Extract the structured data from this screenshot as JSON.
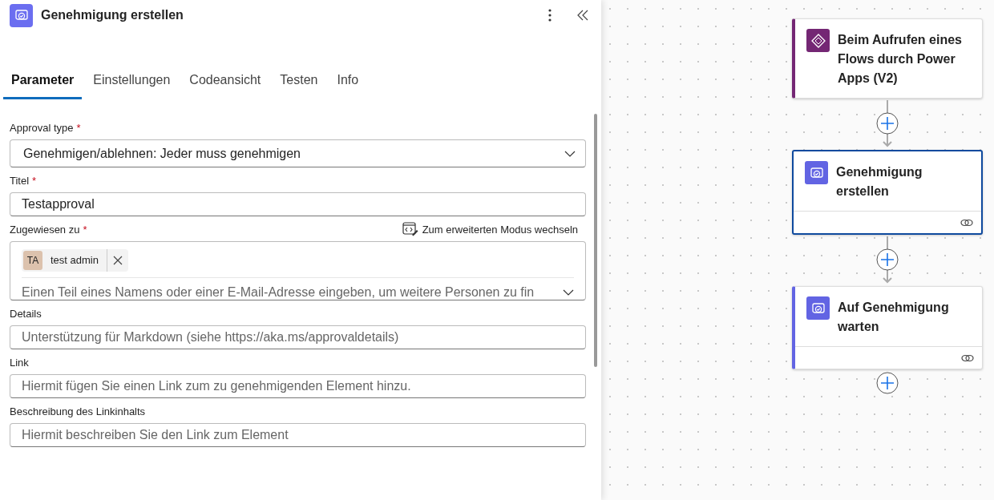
{
  "panel": {
    "title": "Genehmigung erstellen",
    "tabs": [
      {
        "label": "Parameter",
        "selected": true
      },
      {
        "label": "Einstellungen",
        "selected": false
      },
      {
        "label": "Codeansicht",
        "selected": false
      },
      {
        "label": "Testen",
        "selected": false
      },
      {
        "label": "Info",
        "selected": false
      }
    ],
    "fields": [
      {
        "kind": "dropdown",
        "label": "Approval type",
        "required_mark": "*",
        "value": "Genehmigen/ablehnen: Jeder muss genehmigen"
      },
      {
        "kind": "text",
        "label": "Titel",
        "required_mark": "*",
        "value": "Testapproval"
      },
      {
        "kind": "people",
        "label": "Zugewiesen zu",
        "required_mark": "*",
        "action": "Zum erweiterten Modus wechseln",
        "people": [
          {
            "initials": "TA",
            "name": "test admin"
          }
        ],
        "placeholder": "Einen Teil eines Namens oder einer E-Mail-Adresse eingeben, um weitere Personen zu fin"
      },
      {
        "kind": "text",
        "label": "Details",
        "placeholder": "Unterstützung für Markdown (siehe https://aka.ms/approvaldetails)"
      },
      {
        "kind": "text",
        "label": "Link",
        "placeholder": "Hiermit fügen Sie einen Link zum zu genehmigenden Element hinzu."
      },
      {
        "kind": "text",
        "label": "Beschreibung des Linkinhalts",
        "placeholder": "Hiermit beschreiben Sie den Link zum Element"
      }
    ]
  },
  "flow": [
    {
      "kind": "trigger",
      "title": "Beim Aufrufen eines Flows durch Power Apps (V2)",
      "selected": false,
      "color": "#742774"
    },
    {
      "kind": "approval",
      "title": "Genehmigung erstellen",
      "selected": true,
      "color": "#6264e3"
    },
    {
      "kind": "approval",
      "title": "Auf Genehmigung warten",
      "selected": false,
      "color": "#6264e3"
    }
  ]
}
